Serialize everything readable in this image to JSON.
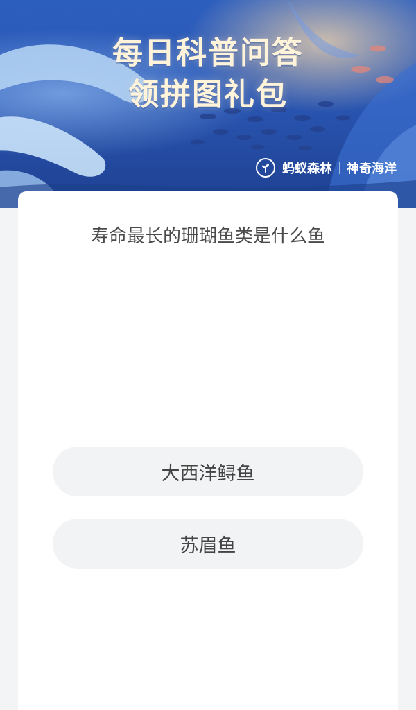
{
  "banner": {
    "title_line1": "每日科普问答",
    "title_line2": "领拼图礼包",
    "brand_primary": "蚂蚁森林",
    "brand_secondary": "神奇海洋",
    "logo_icon": "ant-forest-logo-icon"
  },
  "quiz": {
    "question": "寿命最长的珊瑚鱼类是什么鱼",
    "options": [
      {
        "label": "大西洋鲟鱼"
      },
      {
        "label": "苏眉鱼"
      }
    ]
  },
  "colors": {
    "banner_blue": "#2a57b4",
    "title_cream": "#fff3da",
    "page_bg": "#f3f4f6",
    "option_bg": "#f2f3f5",
    "text_dark": "#444444"
  }
}
